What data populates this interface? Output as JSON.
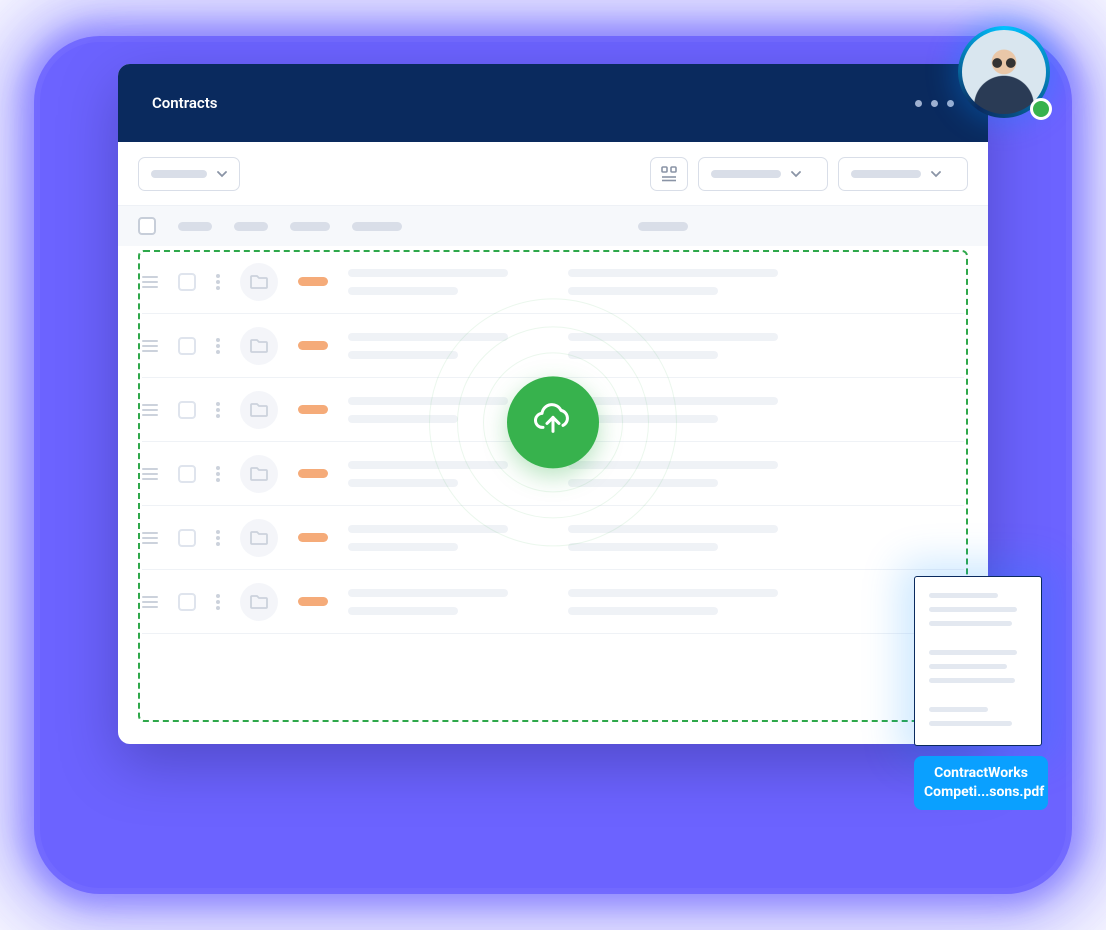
{
  "window": {
    "title": "Contracts"
  },
  "colors": {
    "primary_dark": "#0a2a5e",
    "accent_upload": "#37b24d",
    "dropzone_border": "#2ea84a",
    "file_label_bg": "#0aa0ff",
    "glow": "#6c63ff"
  },
  "file": {
    "name_line1": "ContractWorks",
    "name_line2": "Competi...sons.pdf"
  },
  "rows_count": 6,
  "presence": "online"
}
